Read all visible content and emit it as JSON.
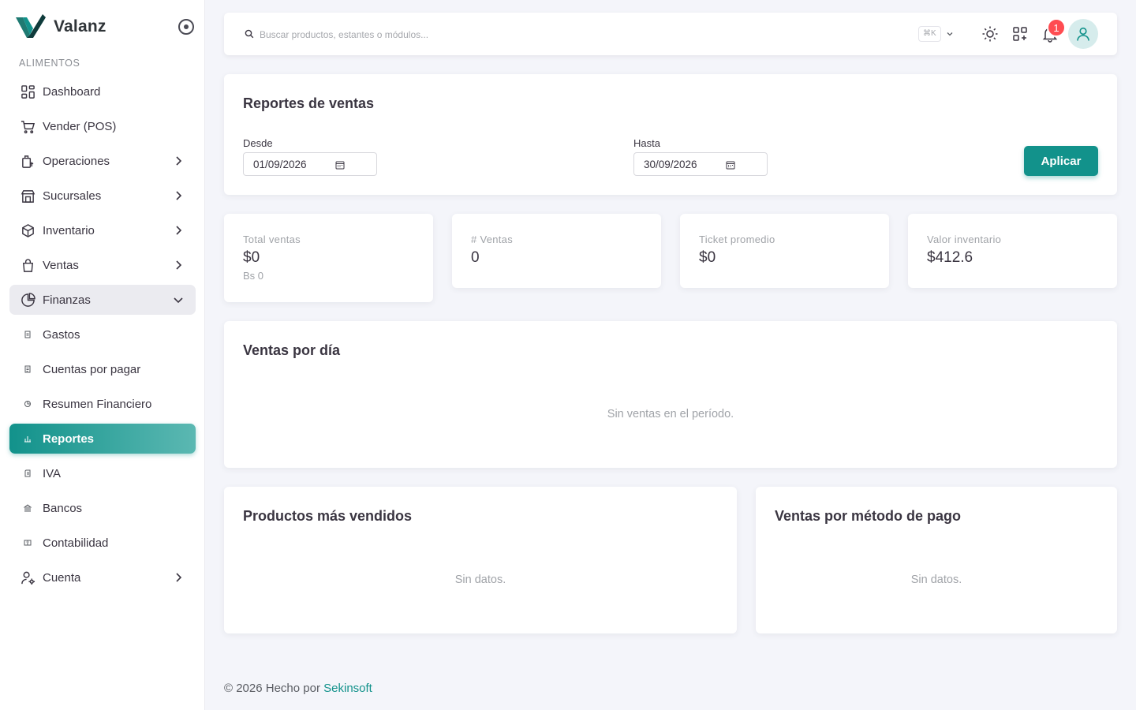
{
  "sidebar": {
    "brand": "Valanz",
    "section": "ALIMENTOS",
    "items": [
      {
        "label": "Dashboard"
      },
      {
        "label": "Vender (POS)"
      },
      {
        "label": "Operaciones"
      },
      {
        "label": "Sucursales"
      },
      {
        "label": "Inventario"
      },
      {
        "label": "Ventas"
      },
      {
        "label": "Finanzas"
      },
      {
        "label": "Gastos"
      },
      {
        "label": "Cuentas por pagar"
      },
      {
        "label": "Resumen Financiero"
      },
      {
        "label": "Reportes"
      },
      {
        "label": "IVA"
      },
      {
        "label": "Bancos"
      },
      {
        "label": "Contabilidad"
      },
      {
        "label": "Cuenta"
      }
    ]
  },
  "topbar": {
    "search_placeholder": "Buscar productos, estantes o módulos...",
    "shortcut": "⌘K",
    "notification_count": "1"
  },
  "report": {
    "title": "Reportes de ventas",
    "from_label": "Desde",
    "from_value": "01/09/2026",
    "to_label": "Hasta",
    "to_value": "30/09/2026",
    "apply_label": "Aplicar"
  },
  "stats": [
    {
      "label": "Total ventas",
      "value": "$0",
      "sub": "Bs 0"
    },
    {
      "label": "# Ventas",
      "value": "0"
    },
    {
      "label": "Ticket promedio",
      "value": "$0"
    },
    {
      "label": "Valor inventario",
      "value": "$412.6"
    }
  ],
  "daily": {
    "title": "Ventas por día",
    "empty": "Sin ventas en el período."
  },
  "top_products": {
    "title": "Productos más vendidos",
    "empty": "Sin datos."
  },
  "payment_methods": {
    "title": "Ventas por método de pago",
    "empty": "Sin datos."
  },
  "footer": {
    "text": "© 2026 Hecho por",
    "link": "Sekinsoft"
  },
  "colors": {
    "accent": "#12928b",
    "badge": "#ff4c51",
    "background": "#f4f5fa"
  }
}
